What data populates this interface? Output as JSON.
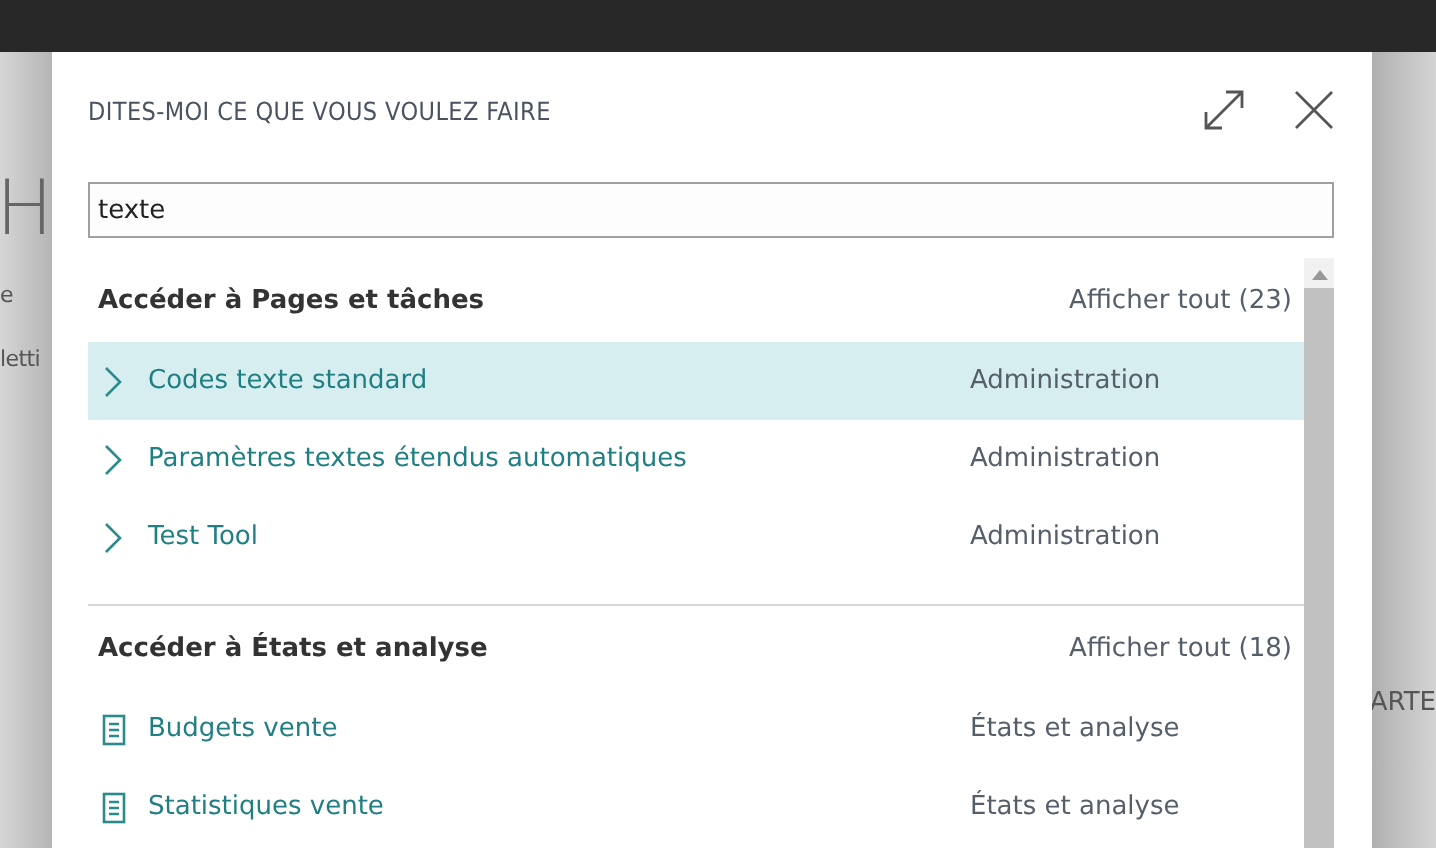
{
  "background": {
    "fragments": [
      {
        "text": "H",
        "kind": "heading"
      },
      {
        "text": "e",
        "kind": "left"
      },
      {
        "text": "letti",
        "kind": "left"
      },
      {
        "text": "ARTE",
        "kind": "right"
      }
    ]
  },
  "dialog": {
    "title": "DITES-MOI CE QUE VOUS VOULEZ FAIRE",
    "search": {
      "value": "texte"
    },
    "sections": [
      {
        "title": "Accéder à Pages et tâches",
        "show_all": "Afficher tout (23)",
        "items": [
          {
            "label": "Codes texte standard",
            "category": "Administration",
            "kind": "page",
            "selected": true
          },
          {
            "label": "Paramètres textes étendus automatiques",
            "category": "Administration",
            "kind": "page",
            "selected": false
          },
          {
            "label": "Test Tool",
            "category": "Administration",
            "kind": "page",
            "selected": false
          }
        ]
      },
      {
        "title": "Accéder à États et analyse",
        "show_all": "Afficher tout (18)",
        "items": [
          {
            "label": "Budgets vente",
            "category": "États et analyse",
            "kind": "report",
            "selected": false
          },
          {
            "label": "Statistiques vente",
            "category": "États et analyse",
            "kind": "report",
            "selected": false
          }
        ]
      }
    ]
  }
}
